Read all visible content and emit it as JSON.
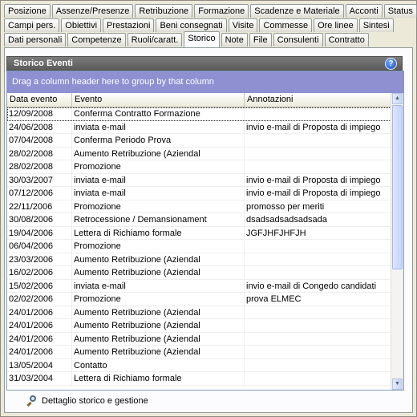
{
  "tabs": {
    "row1": [
      "Posizione",
      "Assenze/Presenze",
      "Retribuzione",
      "Formazione",
      "Scadenze e Materiale",
      "Acconti",
      "Status"
    ],
    "row2": [
      "Campi pers.",
      "Obiettivi",
      "Prestazioni",
      "Beni consegnati",
      "Visite",
      "Commesse",
      "Ore linee",
      "Sintesi"
    ],
    "row3": [
      "Dati personali",
      "Competenze",
      "Ruoli/caratt.",
      "Storico",
      "Note",
      "File",
      "Consulenti",
      "Contratto"
    ],
    "active": "Storico"
  },
  "panel": {
    "title": "Storico Eventi",
    "help_icon": "question-icon",
    "group_hint": "Drag a column header here to group by that column"
  },
  "grid": {
    "columns": [
      "Data evento",
      "Evento",
      "Annotazioni"
    ],
    "rows": [
      [
        "12/09/2008",
        "Conferma Contratto Formazione",
        ""
      ],
      [
        "24/06/2008",
        "inviata e-mail",
        "invio e-mail di Proposta di impiego"
      ],
      [
        "07/04/2008",
        "Conferma Periodo Prova",
        ""
      ],
      [
        "28/02/2008",
        "Aumento Retribuzione (Aziendal",
        ""
      ],
      [
        "28/02/2008",
        "Promozione",
        ""
      ],
      [
        "30/03/2007",
        "inviata e-mail",
        "invio e-mail di Proposta di impiego"
      ],
      [
        "07/12/2006",
        "inviata e-mail",
        "invio e-mail di Proposta di impiego"
      ],
      [
        "22/11/2006",
        "Promozione",
        "promosso per meriti"
      ],
      [
        "30/08/2006",
        "Retrocessione / Demansionament",
        "dsadsadsadsadsada"
      ],
      [
        "19/04/2006",
        "Lettera di Richiamo formale",
        "JGFJHFJHFJH"
      ],
      [
        "06/04/2006",
        "Promozione",
        ""
      ],
      [
        "23/03/2006",
        "Aumento Retribuzione (Aziendal",
        ""
      ],
      [
        "16/02/2006",
        "Aumento Retribuzione (Aziendal",
        ""
      ],
      [
        "15/02/2006",
        "inviata e-mail",
        "invio e-mail di Congedo candidati"
      ],
      [
        "02/02/2006",
        "Promozione",
        "prova ELMEC"
      ],
      [
        "24/01/2006",
        "Aumento Retribuzione (Aziendal",
        ""
      ],
      [
        "24/01/2006",
        "Aumento Retribuzione (Aziendal",
        ""
      ],
      [
        "24/01/2006",
        "Aumento Retribuzione (Aziendal",
        ""
      ],
      [
        "24/01/2006",
        "Aumento Retribuzione (Aziendal",
        ""
      ],
      [
        "13/05/2004",
        "Contatto",
        ""
      ],
      [
        "31/03/2004",
        "Lettera di Richiamo formale",
        ""
      ]
    ]
  },
  "footer": {
    "label": "Dettaglio storico e gestione",
    "icon": "magnifier-icon"
  }
}
